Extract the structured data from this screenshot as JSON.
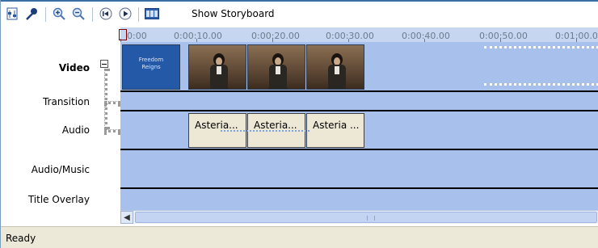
{
  "toolbar": {
    "buttons": [
      {
        "icon": "set-audio-levels-icon"
      },
      {
        "icon": "narrate-timeline-icon"
      },
      {
        "icon": "zoom-in-icon"
      },
      {
        "icon": "zoom-out-icon"
      },
      {
        "icon": "rewind-icon"
      },
      {
        "icon": "play-icon"
      },
      {
        "icon": "storyboard-icon"
      }
    ],
    "storyboard_label": "Show Storyboard"
  },
  "ruler": {
    "labels": [
      "0:00",
      "0:00:10.00",
      "0:00:20.00",
      "0:00:30.00",
      "0:00:40.00",
      "0:00:50.00",
      "0:01:00.0"
    ]
  },
  "tracks": {
    "video": "Video",
    "transition": "Transition",
    "audio": "Audio",
    "audio_music": "Audio/Music",
    "title_overlay": "Title Overlay"
  },
  "video_clips": [
    {
      "type": "title",
      "text_line1": "Freedom",
      "text_line2": "Reigns"
    },
    {
      "type": "thumbnail"
    },
    {
      "type": "thumbnail"
    },
    {
      "type": "thumbnail"
    }
  ],
  "audio_clips": [
    {
      "label": "Asteria..."
    },
    {
      "label": "Asteria..."
    },
    {
      "label": "Asteria ..."
    }
  ],
  "status": {
    "text": "Ready"
  },
  "colors": {
    "track_background": "#a8c0ec",
    "ruler_background": "#c7d6f0",
    "title_clip": "#2459a8",
    "statusbar": "#ece9d8"
  }
}
